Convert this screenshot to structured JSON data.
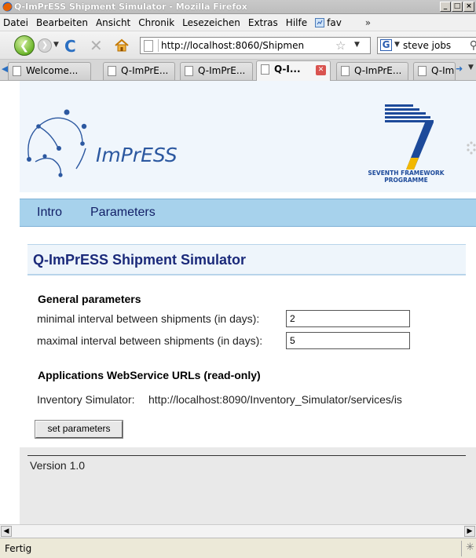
{
  "window": {
    "title": "Q-ImPrESS Shipment Simulator - Mozilla Firefox",
    "controls": [
      "_",
      "□",
      "×"
    ]
  },
  "menubar": {
    "items": [
      "Datei",
      "Bearbeiten",
      "Ansicht",
      "Chronik",
      "Lesezeichen",
      "Extras",
      "Hilfe"
    ],
    "bookmark": "fav",
    "overflow": "»"
  },
  "navbar": {
    "url": "http://localhost:8060/Shipmen",
    "search_query": "steve jobs",
    "search_engine_icon": "G"
  },
  "tabs": [
    {
      "label": "Welcome...",
      "active": false
    },
    {
      "label": "Q-ImPrE...",
      "active": false
    },
    {
      "label": "Q-ImPrE...",
      "active": false
    },
    {
      "label": "Q-I...",
      "active": true
    },
    {
      "label": "Q-ImPrE...",
      "active": false
    },
    {
      "label": "Q-Im",
      "active": false
    }
  ],
  "header": {
    "logo_text": "ImPrESS",
    "fp7_line1": "SEVENTH FRAMEWORK",
    "fp7_line2": "PROGRAMME"
  },
  "nav": {
    "intro": "Intro",
    "parameters": "Parameters"
  },
  "main": {
    "title": "Q-ImPrESS Shipment Simulator",
    "general_heading": "General parameters",
    "min_label": "minimal interval between shipments (in days):",
    "min_value": "2",
    "max_label": "maximal interval between shipments (in days):",
    "max_value": "5",
    "apps_heading": "Applications WebService URLs (read-only)",
    "inventory_label": "Inventory Simulator:",
    "inventory_url": "http://localhost:8090/Inventory_Simulator/services/is",
    "set_button": "set parameters"
  },
  "footer": {
    "version": "Version 1.0"
  },
  "status": {
    "text": "Fertig"
  },
  "colors": {
    "nav_band": "#a7d2ec",
    "title_text": "#1b2a7a",
    "header_bg": "#f0f6fc"
  }
}
